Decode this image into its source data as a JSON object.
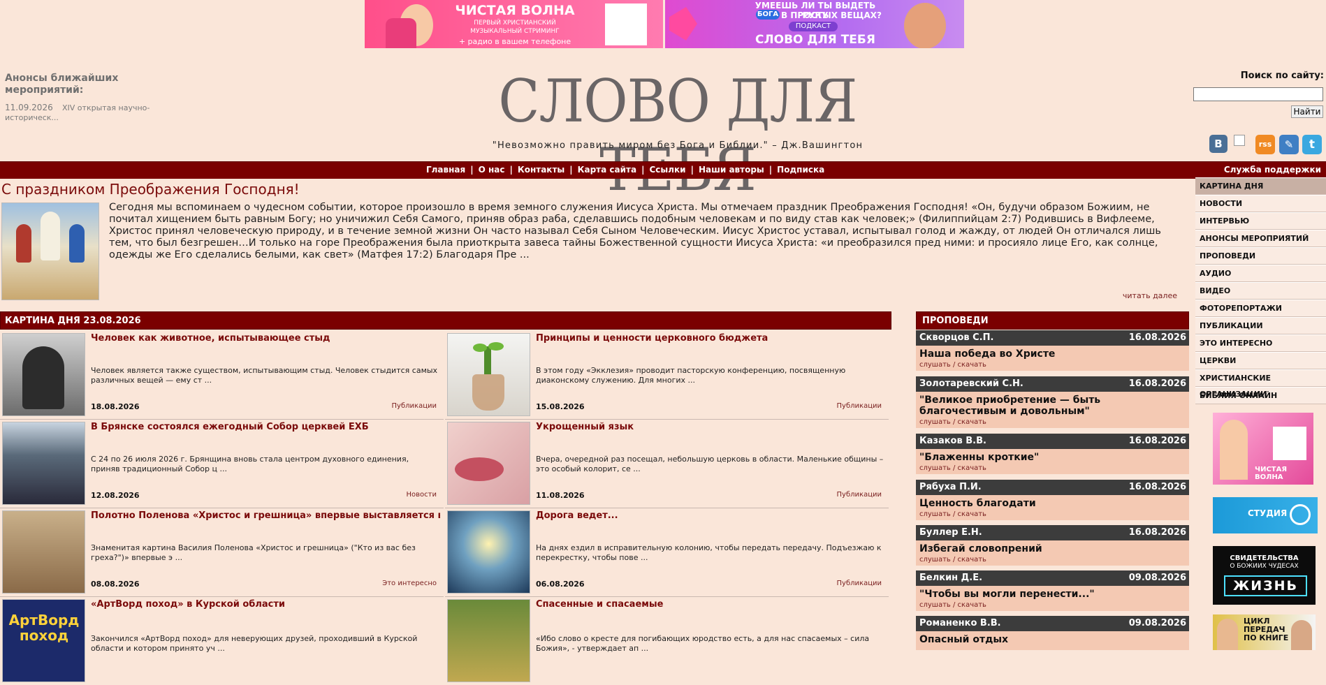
{
  "banners": {
    "left": {
      "brand": "ЧИСТАЯ ВОЛНА",
      "line1": "ПЕРВЫЙ ХРИСТИАНСКИЙ",
      "line2": "МУЗЫКАЛЬНЫЙ СТРИМИНГ",
      "line3": "+ радио в вашем телефоне"
    },
    "right": {
      "line1": "УМЕЕШЬ ЛИ ТЫ ВЫДЕТЬ РУКУ",
      "badge": "БОГА",
      "line2": "В ПРОСТЫХ ВЕЩАХ?",
      "tag": "ПОДКАСТ",
      "brand": "СЛОВО ДЛЯ ТЕБЯ"
    }
  },
  "anons": {
    "heading": "Анонсы ближайших мероприятий:",
    "date": "11.09.2026",
    "text": "XIV открытая научно-историческ..."
  },
  "site": {
    "logo": "СЛОВО ДЛЯ ТЕБЯ",
    "quote": "\"Невозможно править миром без Бога и Библии.\" – Дж.Вашингтон"
  },
  "search": {
    "label": "Поиск по сайту:",
    "value": "",
    "button": "Найти"
  },
  "social": {
    "vk": "B",
    "rss": "rss",
    "edit": "✎",
    "twitter": "t"
  },
  "nav": {
    "items": [
      "Главная",
      "О нас",
      "Контакты",
      "Карта сайта",
      "Ссылки",
      "Наши авторы",
      "Подписка"
    ],
    "support": "Служба поддержки"
  },
  "feature": {
    "title": "С праздником Преображения Господня!",
    "text": "Сегодня мы вспоминаем о чудесном событии, которое произошло в время земного служения Иисуса Христа. Мы отмечаем праздник Преображения Господня! «Он, будучи образом Божиим, не почитал хищением быть равным Богу; но уничижил Себя Самого, приняв образ раба, сделавшись подобным человекам и по виду став как человек;» (Филиппийцам 2:7) Родившись в Вифлееме, Христос принял человеческую природу, и в течение земной жизни Он часто называл Себя Сыном Человеческим. Иисус Христос уставал, испытывал голод и жажду, от людей Он отличался лишь тем, что был безгрешен…И только на горе Преображения была приоткрыта завеса тайны Божественной сущности Иисуса Христа: «и преобразился пред ними: и просияло лице Его, как солнце, одежды же Его сделались белыми, как свет» (Матфея 17:2) Благодаря Пре ...",
    "more": "читать далее"
  },
  "pod": {
    "heading": "КАРТИНА ДНЯ 23.08.2026",
    "cards": [
      {
        "title": "Человек как животное, испытывающее стыд",
        "excerpt": "Человек является также существом, испытывающим стыд. Человек стыдится самых различных вещей — ему ст ...",
        "date": "18.08.2026",
        "category": "Публикации"
      },
      {
        "title": "Принципы и ценности церковного бюджета",
        "excerpt": "В этом году «Экклезия» проводит пасторскую конференцию, посвященную диаконскому служению. Для многих ...",
        "date": "15.08.2026",
        "category": "Публикации"
      },
      {
        "title": "В Брянске состоялся ежегодный Собор церквей ЕХБ",
        "excerpt": "С 24 по 26 июля 2026 г. Брянщина вновь стала центром духовного единения, приняв традиционный Собор ц ...",
        "date": "12.08.2026",
        "category": "Новости"
      },
      {
        "title": "Укрощенный язык",
        "excerpt": "Вчера, очередной раз посещал, небольшую церковь в области. Маленькие общины – это особый колорит, се ...",
        "date": "11.08.2026",
        "category": "Публикации"
      },
      {
        "title": "Полотно Поленова «Христос и грешница» впервые выставляется в...",
        "excerpt": "Знаменитая картина Василия Поленова «Христос и грешница» (\"Кто из вас без греха?\")» впервые э ...",
        "date": "08.08.2026",
        "category": "Это интересно"
      },
      {
        "title": "Дорога ведет...",
        "excerpt": "На днях ездил в исправительную колонию, чтобы передать передачу. Подъезжаю к перекрестку, чтобы пове ...",
        "date": "06.08.2026",
        "category": "Публикации"
      },
      {
        "title": "«АртВорд поход» в Курской области",
        "excerpt": "Закончился «АртВорд поход» для неверующих друзей, проходивший в Курской области и котором принято уч ...",
        "date": "",
        "category": ""
      },
      {
        "title": "Спасенные и спасаемые",
        "excerpt": "«Ибо слово о кресте для погибающих юродство есть, а для нас спасаемых – сила Божия», - утверждает ап ...",
        "date": "",
        "category": ""
      }
    ]
  },
  "sermons": {
    "heading": "ПРОПОВЕДИ",
    "links": "слушать / скачать",
    "items": [
      {
        "author": "Скворцов С.П.",
        "date": "16.08.2026",
        "title": "Наша победа во Христе"
      },
      {
        "author": "Золотаревский С.Н.",
        "date": "16.08.2026",
        "title": "\"Великое приобретение — быть благочестивым и довольным\""
      },
      {
        "author": "Казаков В.В.",
        "date": "16.08.2026",
        "title": "\"Блаженны кроткие\""
      },
      {
        "author": "Рябуха П.И.",
        "date": "16.08.2026",
        "title": "Ценность благодати"
      },
      {
        "author": "Буллер Е.Н.",
        "date": "16.08.2026",
        "title": "Избегай словопрений"
      },
      {
        "author": "Белкин Д.Е.",
        "date": "09.08.2026",
        "title": "\"Чтобы вы могли перенести...\""
      },
      {
        "author": "Романенко В.В.",
        "date": "09.08.2026",
        "title": "Опасный отдых"
      }
    ]
  },
  "menu": [
    "КАРТИНА ДНЯ",
    "НОВОСТИ",
    "ИНТЕРВЬЮ",
    "АНОНСЫ МЕРОПРИЯТИЙ",
    "ПРОПОВЕДИ",
    "АУДИО",
    "ВИДЕО",
    "ФОТОРЕПОРТАЖИ",
    "ПУБЛИКАЦИИ",
    "ЭТО ИНТЕРЕСНО",
    "ЦЕРКВИ",
    "ХРИСТИАНСКИЕ ОРГАНИЗАЦИИ",
    "БИБЛИЯ ОНЛАЙН"
  ],
  "side_ads": {
    "ad1": "ЧИСТАЯ ВОЛНА",
    "ad2": "СТУДИЯ",
    "ad3_line1": "СВИДЕТЕЛЬСТВА",
    "ad3_line2": "О БОЖИИХ ЧУДЕСАХ",
    "ad3_brand": "ЖИЗНЬ",
    "ad4_line1": "ЦИКЛ",
    "ad4_line2": "ПЕРЕДАЧ",
    "ad4_line3": "ПО КНИГЕ"
  },
  "colors": {
    "background": "#fae6d9",
    "accent": "#7a0000",
    "sermon_bar": "#3c3c3c",
    "title_red": "#7a0a0a"
  }
}
